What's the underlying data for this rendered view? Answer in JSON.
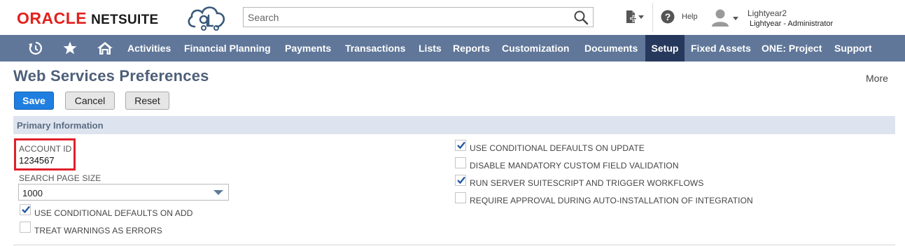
{
  "header": {
    "brand_oracle": "ORACLE",
    "brand_netsuite": "NETSUITE",
    "search_placeholder": "Search",
    "help_label": "Help",
    "user_name": "Lightyear2",
    "user_role": "Lightyear - Administrator"
  },
  "nav": {
    "items": [
      "Activities",
      "Financial Planning",
      "Payments",
      "Transactions",
      "Lists",
      "Reports",
      "Customization",
      "Documents",
      "Setup",
      "Fixed Assets",
      "ONE: Project",
      "Support"
    ],
    "active": "Setup"
  },
  "page": {
    "title": "Web Services Preferences",
    "more": "More",
    "buttons": {
      "save": "Save",
      "cancel": "Cancel",
      "reset": "Reset"
    }
  },
  "section": {
    "title": "Primary Information",
    "account_id_label": "ACCOUNT ID",
    "account_id_value": "1234567",
    "search_page_size_label": "SEARCH PAGE SIZE",
    "search_page_size_value": "1000",
    "left_checkboxes": [
      {
        "label": "USE CONDITIONAL DEFAULTS ON ADD",
        "checked": true
      },
      {
        "label": "TREAT WARNINGS AS ERRORS",
        "checked": false
      }
    ],
    "right_checkboxes": [
      {
        "label": "USE CONDITIONAL DEFAULTS ON UPDATE",
        "checked": true
      },
      {
        "label": "DISABLE MANDATORY CUSTOM FIELD VALIDATION",
        "checked": false
      },
      {
        "label": "RUN SERVER SUITESCRIPT AND TRIGGER WORKFLOWS",
        "checked": true
      },
      {
        "label": "REQUIRE APPROVAL DURING AUTO-INSTALLATION OF INTEGRATION",
        "checked": false
      }
    ]
  },
  "colors": {
    "nav_bg": "#607799",
    "nav_active": "#26385c",
    "brand_red": "#e2211c",
    "primary_button": "#1f7fe0",
    "section_bg": "#dde4ef",
    "highlight_box": "#e0202a"
  },
  "icons": [
    "cloud-logo-icon",
    "search-icon",
    "create-new-icon",
    "help-icon",
    "user-avatar-icon",
    "recent-records-icon",
    "star-icon",
    "home-icon",
    "dropdown-arrow-icon",
    "checkmark-icon"
  ]
}
